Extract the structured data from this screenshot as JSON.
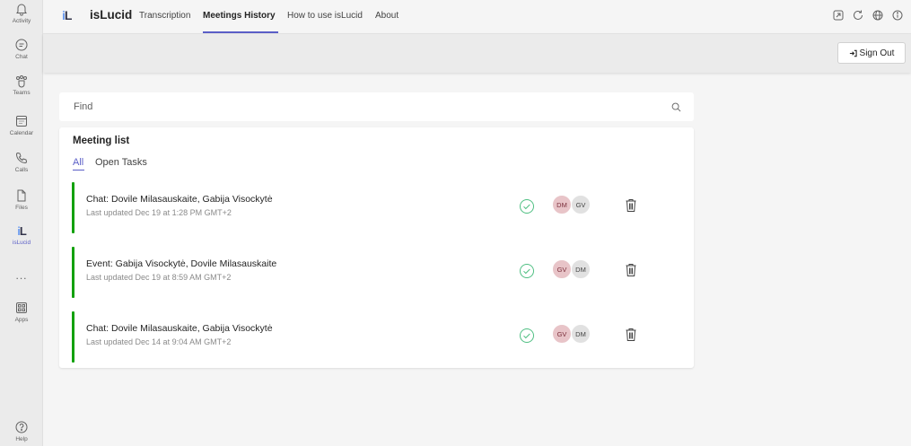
{
  "rail": {
    "items": [
      {
        "label": "Activity",
        "icon": "bell-icon"
      },
      {
        "label": "Chat",
        "icon": "chat-icon"
      },
      {
        "label": "Teams",
        "icon": "teams-icon"
      },
      {
        "label": "Calendar",
        "icon": "calendar-icon"
      },
      {
        "label": "Calls",
        "icon": "phone-icon"
      },
      {
        "label": "Files",
        "icon": "file-icon"
      },
      {
        "label": "isLucid",
        "icon": "islucid-logo-icon"
      },
      {
        "label": "Apps",
        "icon": "apps-icon"
      },
      {
        "label": "Help",
        "icon": "help-icon"
      }
    ],
    "more": "...",
    "logo_text": "iL"
  },
  "header": {
    "logo_text": "iL",
    "app_name": "isLucid",
    "tabs": [
      {
        "label": "Transcription"
      },
      {
        "label": "Meetings History"
      },
      {
        "label": "How to use isLucid"
      },
      {
        "label": "About"
      }
    ],
    "active_tab": "Meetings History"
  },
  "account": {
    "sign_out_label": "Sign Out"
  },
  "search": {
    "placeholder": "Find",
    "value": ""
  },
  "meeting_list": {
    "title": "Meeting list",
    "filters": [
      {
        "label": "All"
      },
      {
        "label": "Open Tasks"
      }
    ],
    "active_filter": "All",
    "rows": [
      {
        "title": "Chat: Dovile Milasauskaite, Gabija Visockytė",
        "updated": "Last updated Dec 19 at 1:28 PM GMT+2",
        "avatars": [
          {
            "initials": "DM"
          },
          {
            "initials": "GV"
          }
        ]
      },
      {
        "title": "Event: Gabija Visockytė, Dovile Milasauskaite",
        "updated": "Last updated Dec 19 at 8:59 AM GMT+2",
        "avatars": [
          {
            "initials": "GV"
          },
          {
            "initials": "DM"
          }
        ]
      },
      {
        "title": "Chat: Dovile Milasauskaite, Gabija Visockytė",
        "updated": "Last updated Dec 14 at 9:04 AM GMT+2",
        "avatars": [
          {
            "initials": "GV"
          },
          {
            "initials": "DM"
          }
        ]
      }
    ]
  },
  "colors": {
    "accent": "#5b5fc7",
    "status_bar": "#13a10e",
    "check": "#4fbf82"
  }
}
